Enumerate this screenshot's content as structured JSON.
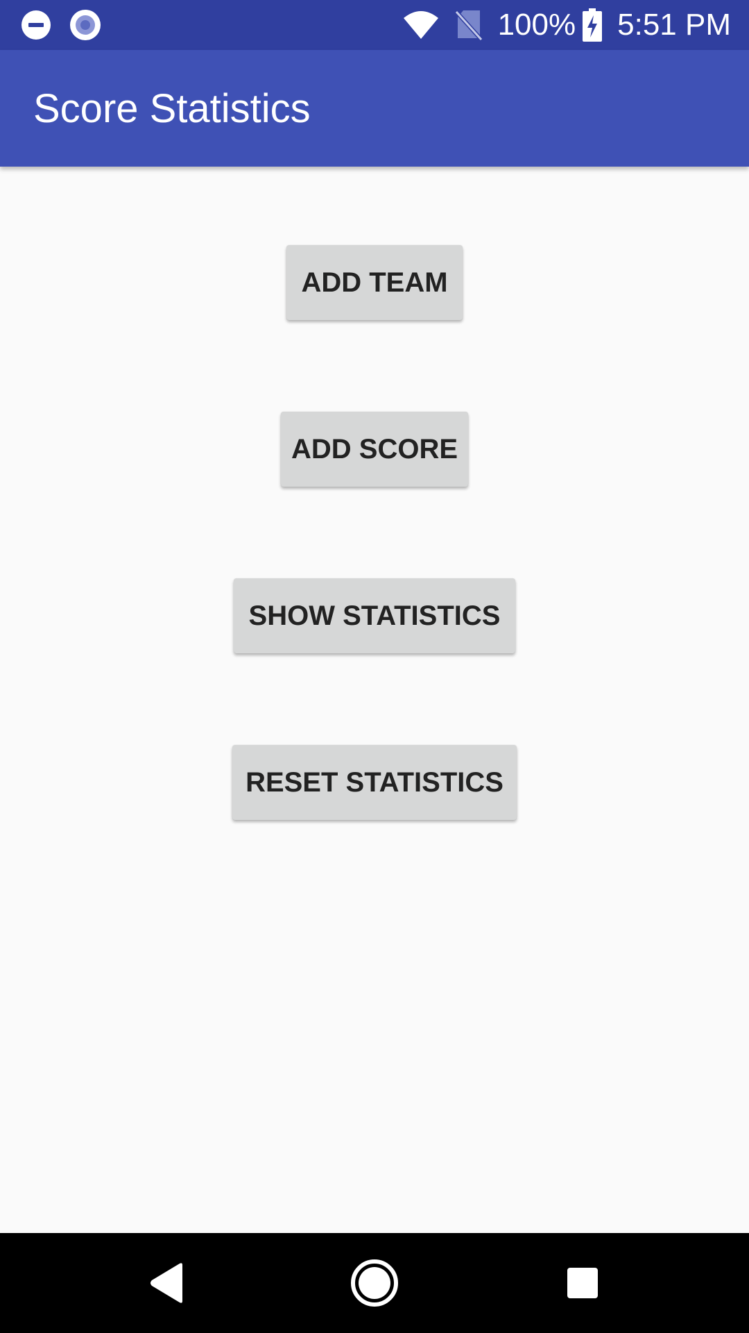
{
  "status_bar": {
    "icons_left": [
      "do-not-disturb-icon",
      "sync-circle-icon"
    ],
    "icons_right": [
      "wifi-icon",
      "no-sim-icon",
      "battery-charging-icon"
    ],
    "battery_percent": "100%",
    "time": "5:51 PM"
  },
  "app_bar": {
    "title": "Score Statistics"
  },
  "buttons": {
    "add_team": "ADD TEAM",
    "add_score": "ADD SCORE",
    "show_statistics": "SHOW STATISTICS",
    "reset_statistics": "RESET STATISTICS"
  },
  "nav_bar": {
    "icons": [
      "back-icon",
      "home-icon",
      "recents-icon"
    ]
  },
  "colors": {
    "status_bar": "#303f9f",
    "app_bar": "#3f51b5",
    "background": "#fafafa",
    "button": "#d6d7d7",
    "nav_bar": "#000000"
  }
}
